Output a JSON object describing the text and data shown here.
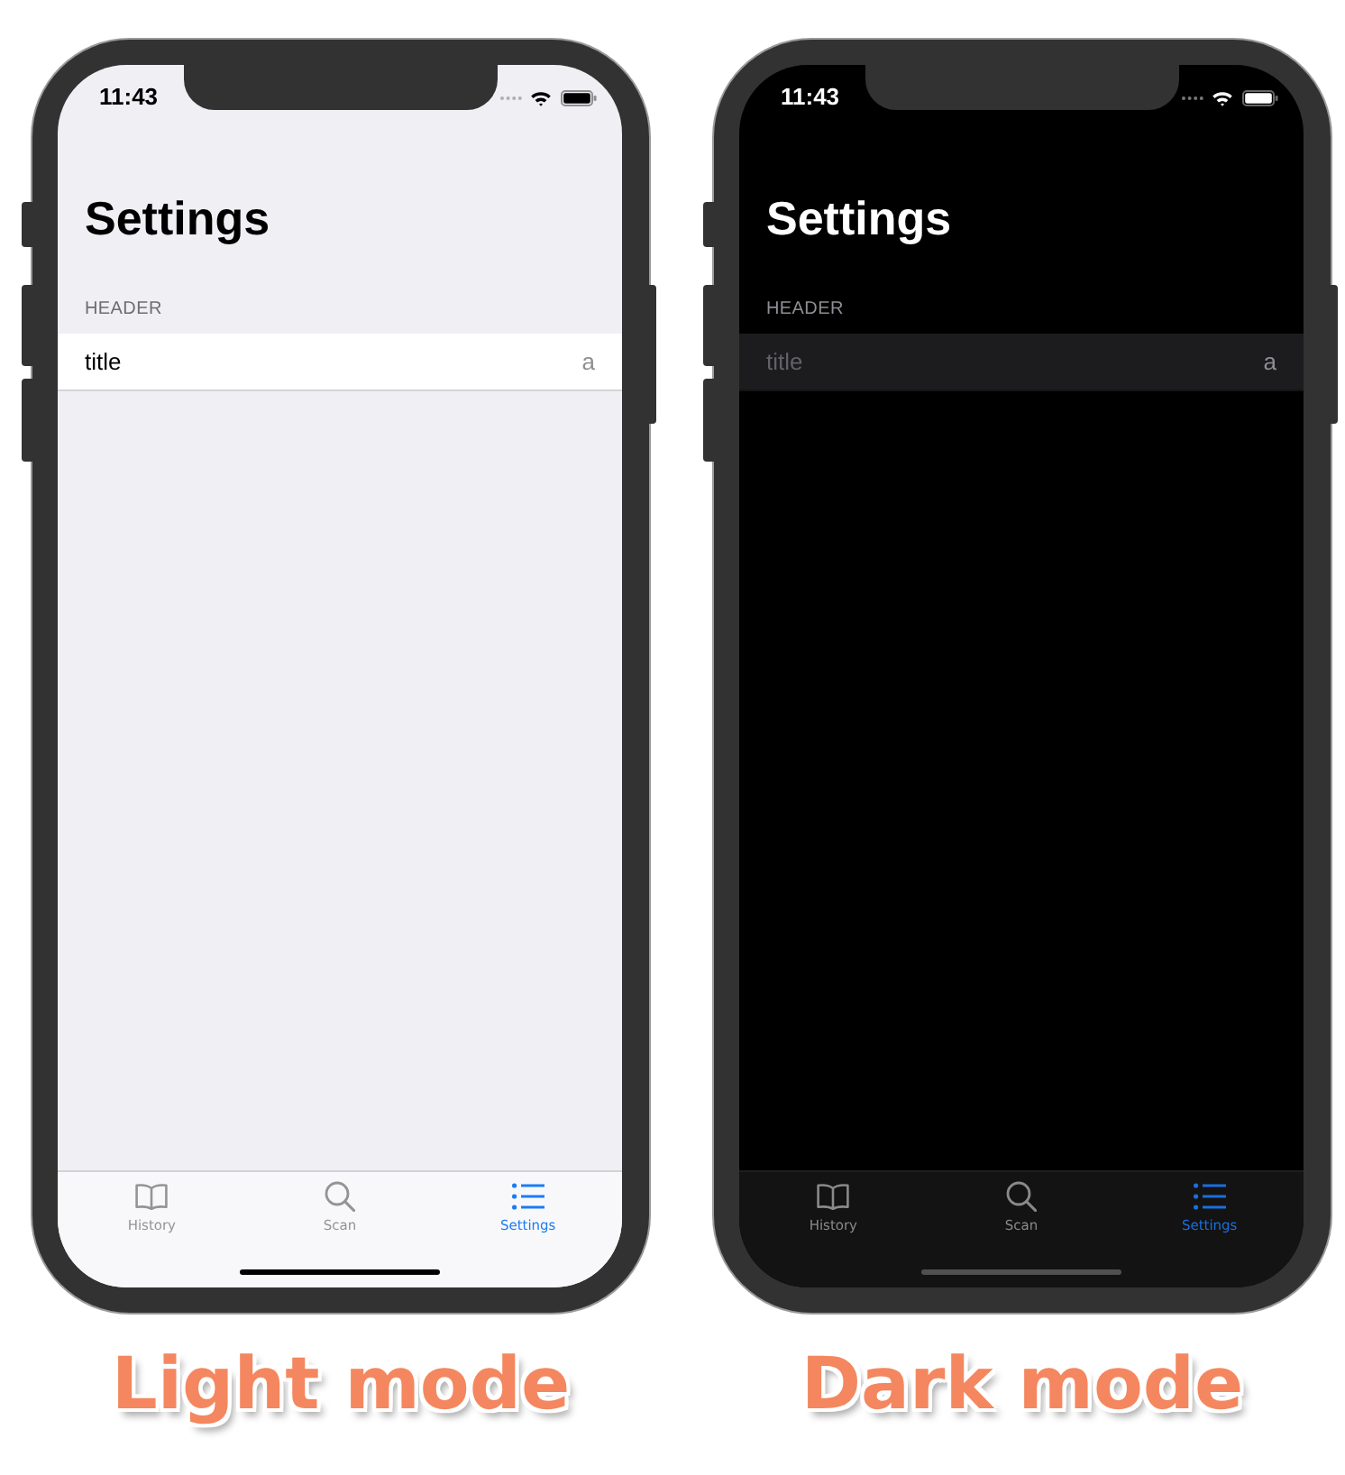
{
  "phones": [
    {
      "kind": "light",
      "status_bar": {
        "time": "11:43"
      },
      "nav_title": "Settings",
      "section": {
        "header": "HEADER",
        "rows": [
          {
            "title": "title",
            "value": "a"
          }
        ]
      },
      "tabs": [
        {
          "kind": "book",
          "label": "History",
          "selected": false
        },
        {
          "kind": "search",
          "label": "Scan",
          "selected": false
        },
        {
          "kind": "list",
          "label": "Settings",
          "selected": true
        }
      ],
      "caption": "Light mode"
    },
    {
      "kind": "dark",
      "status_bar": {
        "time": "11:43"
      },
      "nav_title": "Settings",
      "section": {
        "header": "HEADER",
        "rows": [
          {
            "title": "title",
            "value": "a"
          }
        ]
      },
      "tabs": [
        {
          "kind": "book",
          "label": "History",
          "selected": false
        },
        {
          "kind": "search",
          "label": "Scan",
          "selected": false
        },
        {
          "kind": "list",
          "label": "Settings",
          "selected": true
        }
      ],
      "caption": "Dark mode"
    }
  ]
}
